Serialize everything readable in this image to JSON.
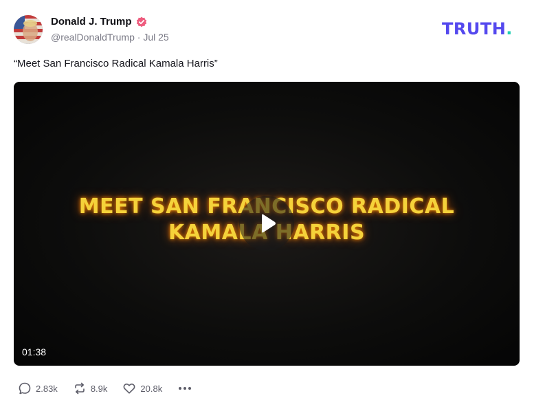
{
  "post": {
    "author_name": "Donald J. Trump",
    "handle": "@realDonaldTrump",
    "separator": "·",
    "date": "Jul 25",
    "text": "“Meet San Francisco Radical Kamala Harris”"
  },
  "brand": {
    "name": "TRUTH",
    "dot": ".",
    "color": "#5448ee",
    "dot_color": "#1fcfb3"
  },
  "video": {
    "title_line1": "MEET SAN FRANCISCO RADICAL",
    "title_line2": "KAMALA HARRIS",
    "duration": "01:38",
    "play_icon": "play-icon"
  },
  "actions": {
    "replies": "2.83k",
    "retruths": "8.9k",
    "likes": "20.8k",
    "reply_icon": "comment-icon",
    "retruth_icon": "repost-icon",
    "like_icon": "heart-icon",
    "more_icon": "more-icon"
  }
}
